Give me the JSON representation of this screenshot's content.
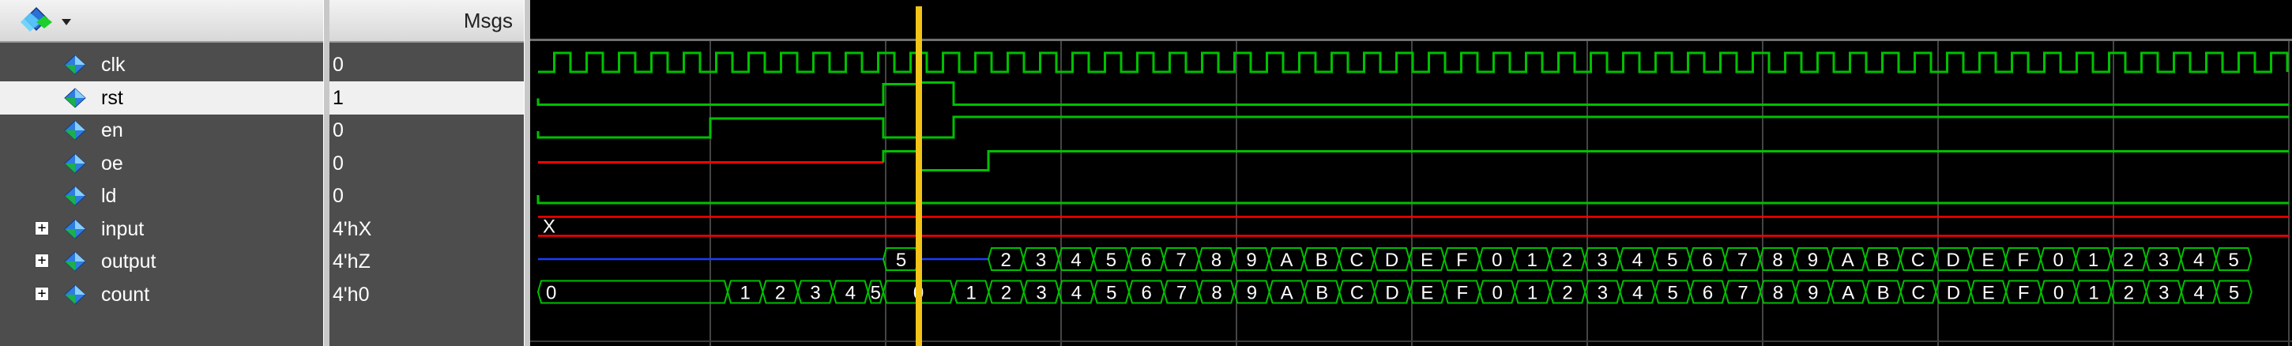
{
  "names_header": {
    "tool_icon": "waveform-toolbar-icon"
  },
  "values_header": {
    "label": "Msgs"
  },
  "signals": [
    {
      "name": "clk",
      "value": "0",
      "expandable": false,
      "selected": false,
      "color": "#00c000"
    },
    {
      "name": "rst",
      "value": "1",
      "expandable": false,
      "selected": true,
      "color": "#00c000"
    },
    {
      "name": "en",
      "value": "0",
      "expandable": false,
      "selected": false,
      "color": "#00c000"
    },
    {
      "name": "oe",
      "value": "0",
      "expandable": false,
      "selected": false,
      "color": "#00c000"
    },
    {
      "name": "ld",
      "value": "0",
      "expandable": false,
      "selected": false,
      "color": "#00c000"
    },
    {
      "name": "input",
      "value": "4'hX",
      "expandable": true,
      "selected": false,
      "color": "#ff0000"
    },
    {
      "name": "output",
      "value": "4'hZ",
      "expandable": true,
      "selected": false,
      "color": "#00c000"
    },
    {
      "name": "count",
      "value": "4'h0",
      "expandable": true,
      "selected": false,
      "color": "#00c000"
    }
  ],
  "wave_labels": {
    "input": [
      "X"
    ],
    "output": [
      "5",
      "2",
      "3",
      "4",
      "5",
      "6",
      "7",
      "8",
      "9",
      "A",
      "B",
      "C",
      "D",
      "E",
      "F",
      "0",
      "1",
      "2",
      "3",
      "4",
      "5",
      "6",
      "7",
      "8",
      "9",
      "A",
      "B",
      "C",
      "D",
      "E",
      "F",
      "0",
      "1",
      "2",
      "3",
      "4",
      "5"
    ],
    "count": [
      "0",
      "1",
      "2",
      "3",
      "4",
      "5",
      "0",
      "1",
      "2",
      "3",
      "4",
      "5",
      "6",
      "7",
      "8",
      "9",
      "A",
      "B",
      "C",
      "D",
      "E",
      "F",
      "0",
      "1",
      "2",
      "3",
      "4",
      "5",
      "6",
      "7",
      "8",
      "9",
      "A",
      "B",
      "C",
      "D",
      "E",
      "F",
      "0",
      "1",
      "2",
      "3",
      "4",
      "5"
    ]
  },
  "colors": {
    "wave": "#00c000",
    "undefined": "#ff0000",
    "highz": "#1a3cff",
    "cursor": "#f2c318",
    "grid": "#5a5a5a"
  }
}
